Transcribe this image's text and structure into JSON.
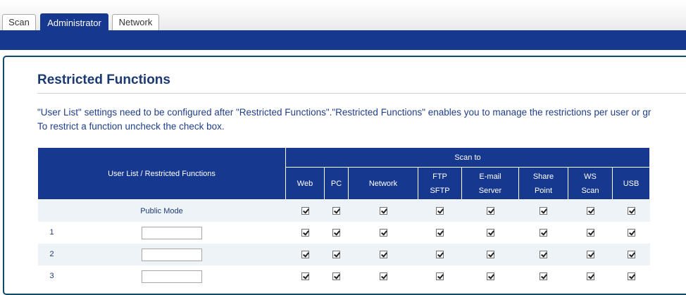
{
  "tabs": [
    {
      "label": "Scan",
      "active": false
    },
    {
      "label": "Administrator",
      "active": true
    },
    {
      "label": "Network",
      "active": false
    }
  ],
  "page": {
    "title": "Restricted Functions",
    "description_line1": "\"User List\" settings need to be configured after \"Restricted Functions\".\"Restricted Functions\" enables you to manage the restrictions per user or gr",
    "description_line2": "To restrict a function uncheck the check box."
  },
  "table": {
    "corner_header": "User List / Restricted Functions",
    "group_header": "Scan to",
    "columns": [
      {
        "line1": "Web",
        "line2": ""
      },
      {
        "line1": "PC",
        "line2": ""
      },
      {
        "line1": "Network",
        "line2": ""
      },
      {
        "line1": "FTP",
        "line2": "SFTP"
      },
      {
        "line1": "E-mail",
        "line2": "Server"
      },
      {
        "line1": "Share",
        "line2": "Point"
      },
      {
        "line1": "WS",
        "line2": "Scan"
      },
      {
        "line1": "USB",
        "line2": ""
      }
    ],
    "public_mode_label": "Public Mode",
    "public_mode_checks": [
      true,
      true,
      true,
      true,
      true,
      true,
      true,
      true
    ],
    "rows": [
      {
        "number": "1",
        "name": "",
        "checks": [
          true,
          true,
          true,
          true,
          true,
          true,
          true,
          true
        ]
      },
      {
        "number": "2",
        "name": "",
        "checks": [
          true,
          true,
          true,
          true,
          true,
          true,
          true,
          true
        ]
      },
      {
        "number": "3",
        "name": "",
        "checks": [
          true,
          true,
          true,
          true,
          true,
          true,
          true,
          true
        ]
      }
    ]
  },
  "colors": {
    "header_blue": "#17388f",
    "title_text": "#1b3a73",
    "description_text": "#1f3f8a",
    "alt_row": "#eef3f8"
  }
}
